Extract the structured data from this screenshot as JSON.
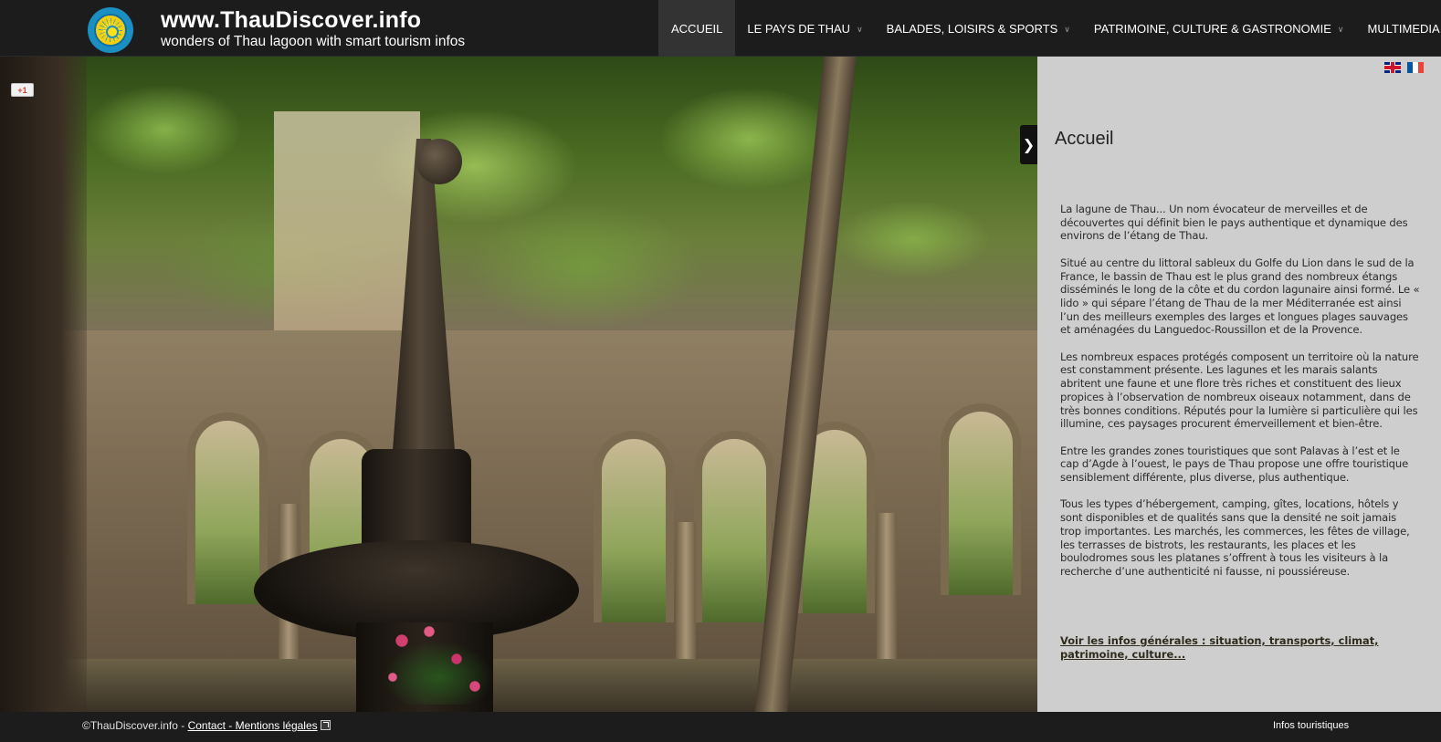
{
  "header": {
    "site_title": "www.ThauDiscover.info",
    "tagline": "wonders of Thau lagoon with smart tourism infos",
    "nav": [
      {
        "label": "ACCUEIL",
        "active": true
      },
      {
        "label": "LE PAYS DE THAU",
        "has_dropdown": true
      },
      {
        "label": "BALADES, LOISIRS & SPORTS",
        "has_dropdown": true
      },
      {
        "label": "PATRIMOINE, CULTURE & GASTRONOMIE",
        "has_dropdown": true
      },
      {
        "label": "MULTIMEDIA",
        "has_dropdown": true
      }
    ]
  },
  "social": {
    "gplus_label": "+1"
  },
  "panel": {
    "title": "Accueil",
    "paragraphs": [
      " La lagune de Thau... Un nom évocateur de merveilles et de découvertes qui définit bien le pays authentique et dynamique des environs de l’étang de Thau.",
      "Situé au centre du littoral sableux du Golfe du Lion dans le sud de la France, le bassin de Thau est le plus grand des nombreux étangs disséminés le long de la côte et du cordon lagunaire ainsi formé. Le « lido » qui sépare l’étang de Thau de la mer Méditerranée est ainsi l’un des meilleurs exemples des larges et longues plages sauvages et aménagées du Languedoc-Roussillon et de la Provence.",
      "Les nombreux espaces protégés composent un territoire où la nature est constamment présente. Les lagunes et les marais salants abritent une faune et une flore très riches et constituent des lieux propices à l’observation de nombreux oiseaux notamment, dans de très bonnes conditions. Réputés pour la lumière si particulière qui les illumine,  ces paysages procurent émerveillement et bien-être.",
      "Entre les grandes zones touristiques que sont Palavas à l’est et le cap d’Agde à l’ouest, le pays de Thau propose une offre touristique sensiblement différente,  plus diverse, plus authentique.",
      "Tous les types d’hébergement, camping, gîtes, locations, hôtels y sont disponibles et de qualités sans que la densité ne soit jamais trop importantes. Les marchés, les commerces, les fêtes de village, les terrasses de bistrots, les restaurants, les places et les boulodromes sous les platanes s’offrent à tous les visiteurs à la recherche d’une authenticité ni fausse, ni poussiéreuse."
    ],
    "link_text": "Voir les infos générales : situation, transports, climat, patrimoine, culture...",
    "toggle_glyph": "❯"
  },
  "footer": {
    "copyright": "©ThauDiscover.info - ",
    "contact_link": "Contact - Mentions légales",
    "right_link": "Infos touristiques"
  },
  "icons": {
    "logo": "sun-wheel-logo-icon",
    "uk_flag": "uk-flag-icon",
    "fr_flag": "french-flag-icon",
    "external": "external-link-icon"
  },
  "colors": {
    "header_bg": "#1c1c1c",
    "active_nav_bg": "#333333",
    "panel_bg": "#e2e2e2",
    "logo_blue": "#1b8fc2",
    "logo_yellow": "#ffe11a"
  }
}
